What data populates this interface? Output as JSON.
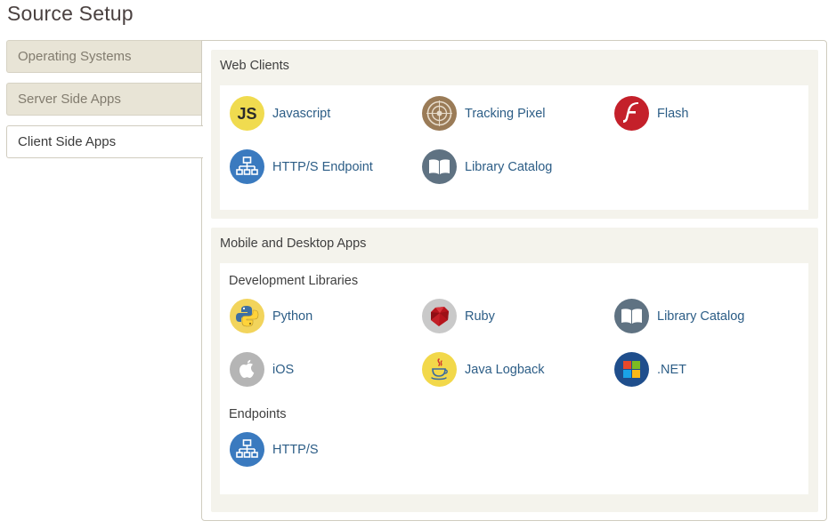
{
  "page": {
    "title": "Source Setup"
  },
  "tabs": [
    {
      "label": "Operating Systems",
      "active": false
    },
    {
      "label": "Server Side Apps",
      "active": false
    },
    {
      "label": "Client Side Apps",
      "active": true
    }
  ],
  "web_clients": {
    "title": "Web Clients",
    "items": [
      {
        "label": "Javascript",
        "icon": "javascript-icon"
      },
      {
        "label": "Tracking Pixel",
        "icon": "tracking-pixel-icon"
      },
      {
        "label": "Flash",
        "icon": "flash-icon"
      },
      {
        "label": "HTTP/S Endpoint",
        "icon": "network-icon"
      },
      {
        "label": "Library Catalog",
        "icon": "book-icon"
      }
    ]
  },
  "mobile_desktop": {
    "title": "Mobile and Desktop Apps",
    "dev_libraries": {
      "title": "Development Libraries",
      "items": [
        {
          "label": "Python",
          "icon": "python-icon"
        },
        {
          "label": "Ruby",
          "icon": "ruby-icon"
        },
        {
          "label": "Library Catalog",
          "icon": "book-icon"
        },
        {
          "label": "iOS",
          "icon": "apple-icon"
        },
        {
          "label": "Java Logback",
          "icon": "java-icon"
        },
        {
          "label": ".NET",
          "icon": "windows-icon"
        }
      ]
    },
    "endpoints": {
      "title": "Endpoints",
      "items": [
        {
          "label": "HTTP/S",
          "icon": "network-icon"
        }
      ]
    }
  },
  "colors": {
    "link": "#2c5d86",
    "tab_inactive_bg": "#e8e4d6",
    "section_bg": "#f4f3ec",
    "network_blue": "#3a7abf",
    "flash_red": "#c4202a",
    "js_yellow": "#f0db4f"
  }
}
